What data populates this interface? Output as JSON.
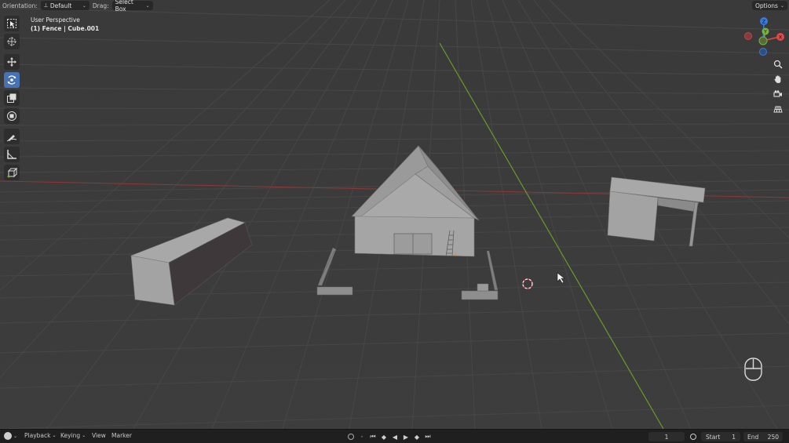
{
  "header": {
    "orientation_label": "Orientation:",
    "orientation_value": "Default",
    "drag_label": "Drag:",
    "drag_value": "Select Box",
    "options_label": "Options"
  },
  "viewport_overlay": {
    "view_name": "User Perspective",
    "selection_info": "(1) Fence | Cube.001"
  },
  "toolbar": {
    "tools": [
      "select-box",
      "cursor",
      "move",
      "rotate",
      "scale",
      "transform",
      "annotate",
      "measure",
      "add-cube"
    ],
    "active_tool": "rotate"
  },
  "gizmo": {
    "axes": [
      "Z",
      "Y",
      "X"
    ],
    "colors": {
      "x": "#e04a4a",
      "y": "#7ab33e",
      "z": "#3c7ad6"
    }
  },
  "navigation": [
    "zoom-icon",
    "hand-icon",
    "camera-icon",
    "grid-icon"
  ],
  "timeline": {
    "menus": [
      "Playback",
      "Keying",
      "View",
      "Marker"
    ],
    "current_frame": "1",
    "start_label": "Start",
    "start_value": "1",
    "end_label": "End",
    "end_value": "250"
  },
  "colors": {
    "viewport_bg": "#3a3a3a",
    "grid": "#444444",
    "x_axis": "#9a3a3a",
    "y_axis": "#6e9a2c",
    "active_tool": "#4772b3"
  }
}
